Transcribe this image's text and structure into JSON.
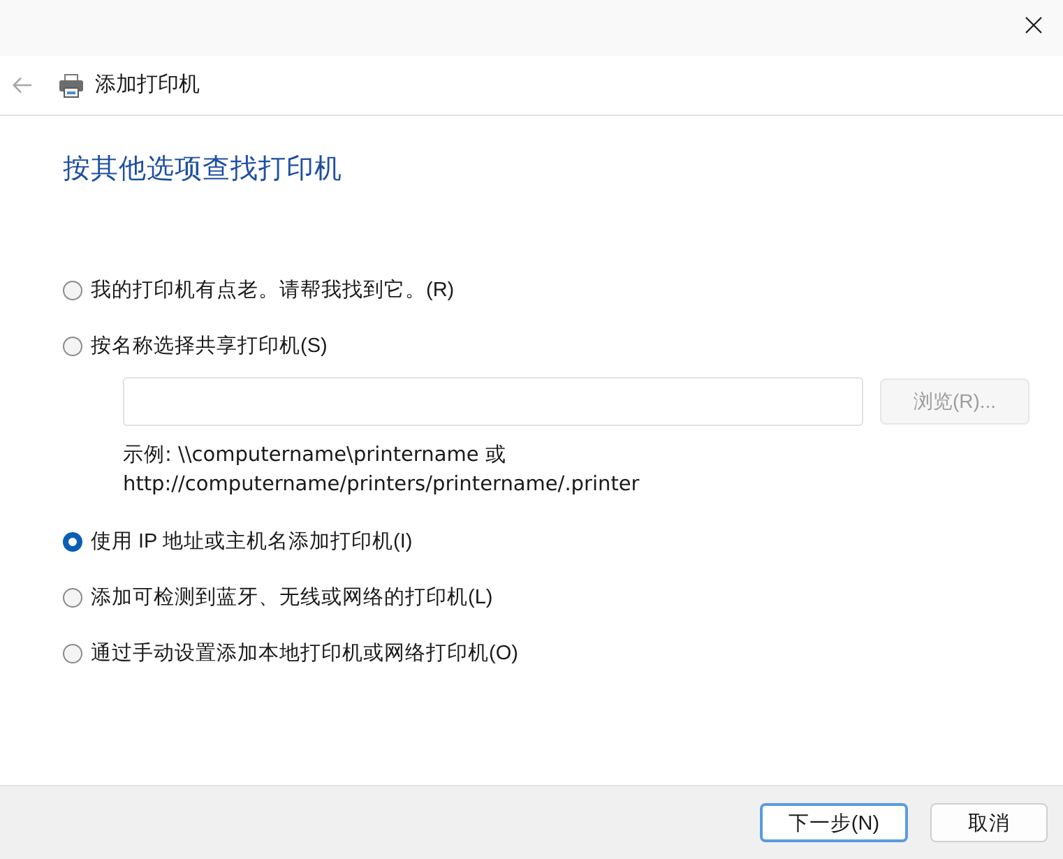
{
  "header": {
    "title": "添加打印机",
    "back_disabled": true
  },
  "heading": "按其他选项查找打印机",
  "options": [
    {
      "kind": "plain",
      "label": "我的打印机有点老。请帮我找到它。(R)",
      "selected": false
    },
    {
      "kind": "path",
      "label": "按名称选择共享打印机(S)",
      "selected": false,
      "browse": {
        "label": "浏览(R)...",
        "disabled": true
      },
      "example": "示例: \\\\computername\\printername 或 http://computername/printers/printername/.printer"
    },
    {
      "kind": "plain",
      "label": "使用 IP 地址或主机名添加打印机(I)",
      "selected": true
    },
    {
      "kind": "plain",
      "label": "添加可检测到蓝牙、无线或网络的打印机(L)",
      "selected": false
    },
    {
      "kind": "plain",
      "label": "通过手动设置添加本地打印机或网络打印机(O)",
      "selected": false
    }
  ],
  "buttons": [
    {
      "label": "下一步(N)",
      "default": true
    },
    {
      "label": "取消",
      "default": false
    }
  ]
}
